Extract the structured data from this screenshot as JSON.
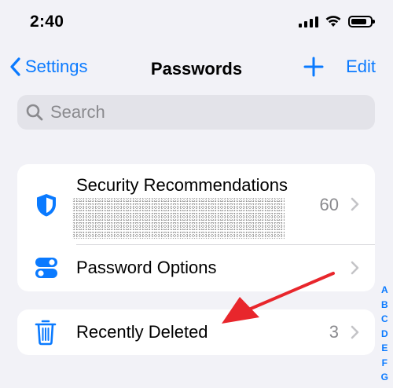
{
  "status_bar": {
    "time": "2:40"
  },
  "nav": {
    "back_label": "Settings",
    "title": "Passwords",
    "edit_label": "Edit"
  },
  "search": {
    "placeholder": "Search"
  },
  "groups": {
    "security": {
      "label": "Security Recommendations",
      "count": "60"
    },
    "options": {
      "label": "Password Options"
    },
    "deleted": {
      "label": "Recently Deleted",
      "count": "3"
    }
  },
  "index_letters": [
    "A",
    "B",
    "C",
    "D",
    "E",
    "F",
    "G"
  ],
  "icons": {
    "back": "chevron-left-icon",
    "add": "plus-icon",
    "search": "magnifying-glass-icon",
    "security": "shield-icon",
    "options": "toggle-icon",
    "deleted": "trash-icon"
  },
  "colors": {
    "accent": "#0a7aff",
    "annotation": "#e8262c",
    "background": "#f2f2f7"
  }
}
